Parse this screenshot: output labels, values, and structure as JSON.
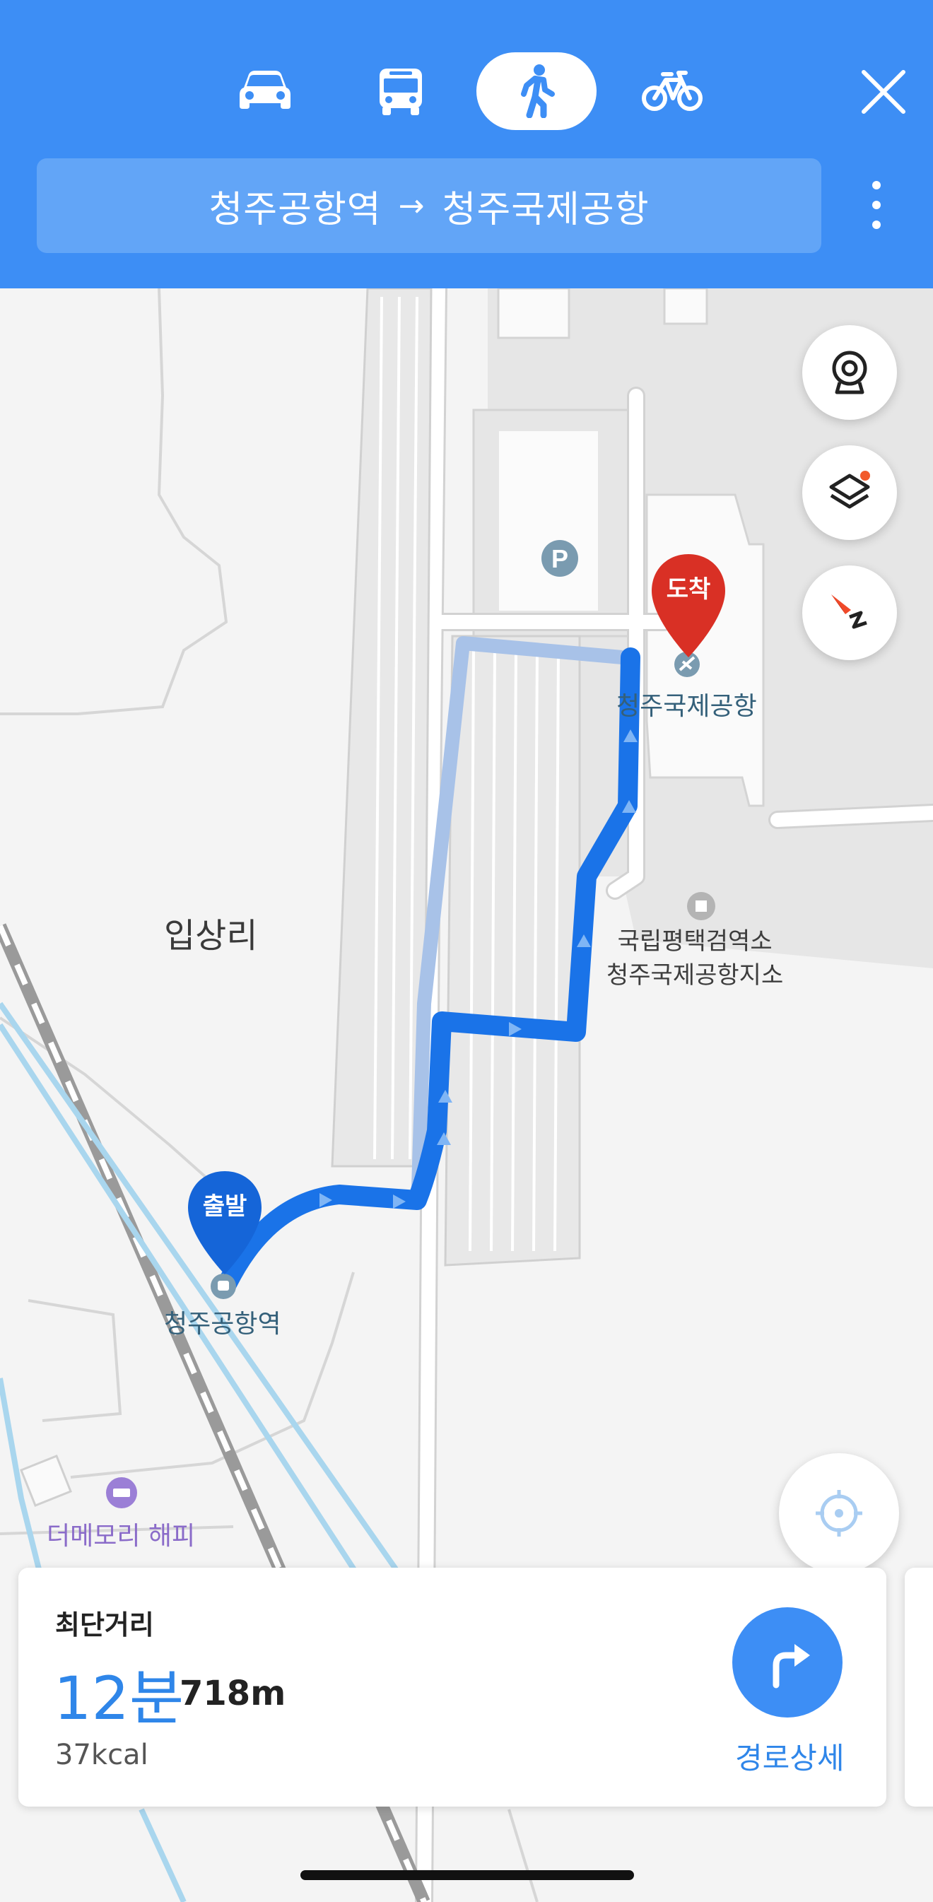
{
  "header": {
    "modes": [
      {
        "name": "car",
        "icon": "car-icon",
        "active": false
      },
      {
        "name": "bus",
        "icon": "bus-icon",
        "active": false
      },
      {
        "name": "walk",
        "icon": "walking-person-icon",
        "active": true
      },
      {
        "name": "bike",
        "icon": "bicycle-icon",
        "active": false
      }
    ],
    "close_icon": "close-icon",
    "route": {
      "origin": "청주공항역",
      "arrow": "→",
      "destination": "청주국제공항"
    },
    "more_icon": "more-vertical-icon"
  },
  "map": {
    "place_label": "입상리",
    "origin_pin": {
      "text": "출발",
      "label": "청주공항역"
    },
    "destination_pin": {
      "text": "도착",
      "label": "청주국제공항"
    },
    "poi_quarantine": {
      "line1": "국립평택검역소",
      "line2": "청주국제공항지소"
    },
    "poi_hotel": "더메모리 해피",
    "parking_icon": "P",
    "controls": [
      "cctv-icon",
      "layers-icon",
      "compass-icon",
      "my-location-icon"
    ]
  },
  "colors": {
    "header": "#3d8ef5",
    "route": "#1a73e8",
    "accent": "#2f86e9",
    "destination_pin": "#d93025",
    "origin_pin": "#1565d8"
  },
  "result": {
    "type": "최단거리",
    "time": "12분",
    "distance": "718m",
    "calories": "37kcal",
    "detail_label": "경로상세"
  }
}
